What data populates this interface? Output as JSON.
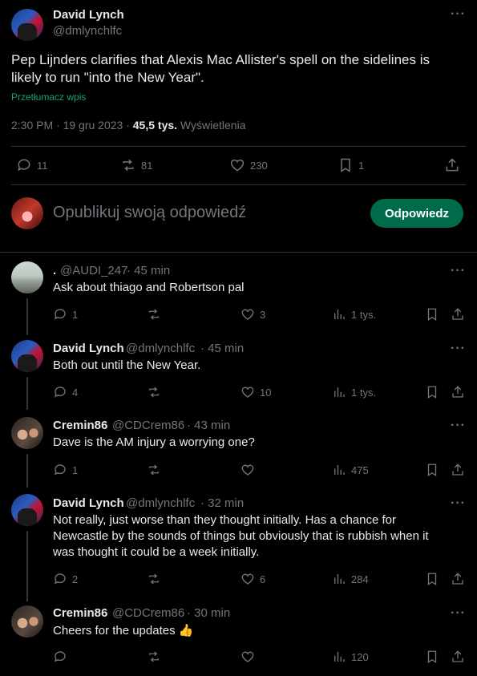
{
  "main_post": {
    "author": "David Lynch",
    "handle": "@dmlynchlfc",
    "more": "···",
    "text": "Pep Lijnders clarifies that Alexis Mac Allister's spell on the sidelines is likely to run \"into the New Year\".",
    "translate": "Przetłumacz wpis",
    "time": "2:30 PM · 19 gru 2023 ·",
    "views_count": "45,5 tys.",
    "views_label": "Wyświetlenia",
    "replies": "11",
    "reposts": "81",
    "likes": "230",
    "bookmarks": "1"
  },
  "compose": {
    "placeholder": "Opublikuj swoją odpowiedź",
    "button": "Odpowiedz"
  },
  "replies": [
    {
      "author": ".",
      "handle": "@AUDI_247",
      "time": "· 45 min",
      "text": "Ask about thiago and Robertson pal",
      "replies": "1",
      "reposts": "",
      "likes": "3",
      "views": "1 tys.",
      "avatar": "landscape"
    },
    {
      "author": "David Lynch",
      "handle": "@dmlynchlfc",
      "time": "· 45 min",
      "text": "Both out until the New Year.",
      "replies": "4",
      "reposts": "",
      "likes": "10",
      "views": "1 tys.",
      "avatar": "david"
    },
    {
      "author": "Cremin86",
      "handle": "@CDCrem86",
      "time": "· 43 min",
      "text": "Dave is the AM injury a worrying one?",
      "replies": "1",
      "reposts": "",
      "likes": "",
      "views": "475",
      "avatar": "cremin"
    },
    {
      "author": "David Lynch",
      "handle": "@dmlynchlfc",
      "time": "· 32 min",
      "text_lines": [
        "Not really, just worse than they thought initially. Has a chance for",
        "Newcastle by the sounds of things but obviously that is rubbish when it",
        "was thought it could be a week initially."
      ],
      "replies": "2",
      "reposts": "",
      "likes": "6",
      "views": "284",
      "avatar": "david"
    },
    {
      "author": "Cremin86",
      "handle": "@CDCrem86",
      "time": "· 30 min",
      "text": "Cheers for the updates",
      "emoji": "👍",
      "replies": "",
      "reposts": "",
      "likes": "",
      "views": "120",
      "avatar": "cremin"
    }
  ],
  "more": "···",
  "colors": {
    "accent_green": "#006b4a",
    "translate_link": "#1d9bf0",
    "muted": "#71767b",
    "border": "#2f3336"
  }
}
